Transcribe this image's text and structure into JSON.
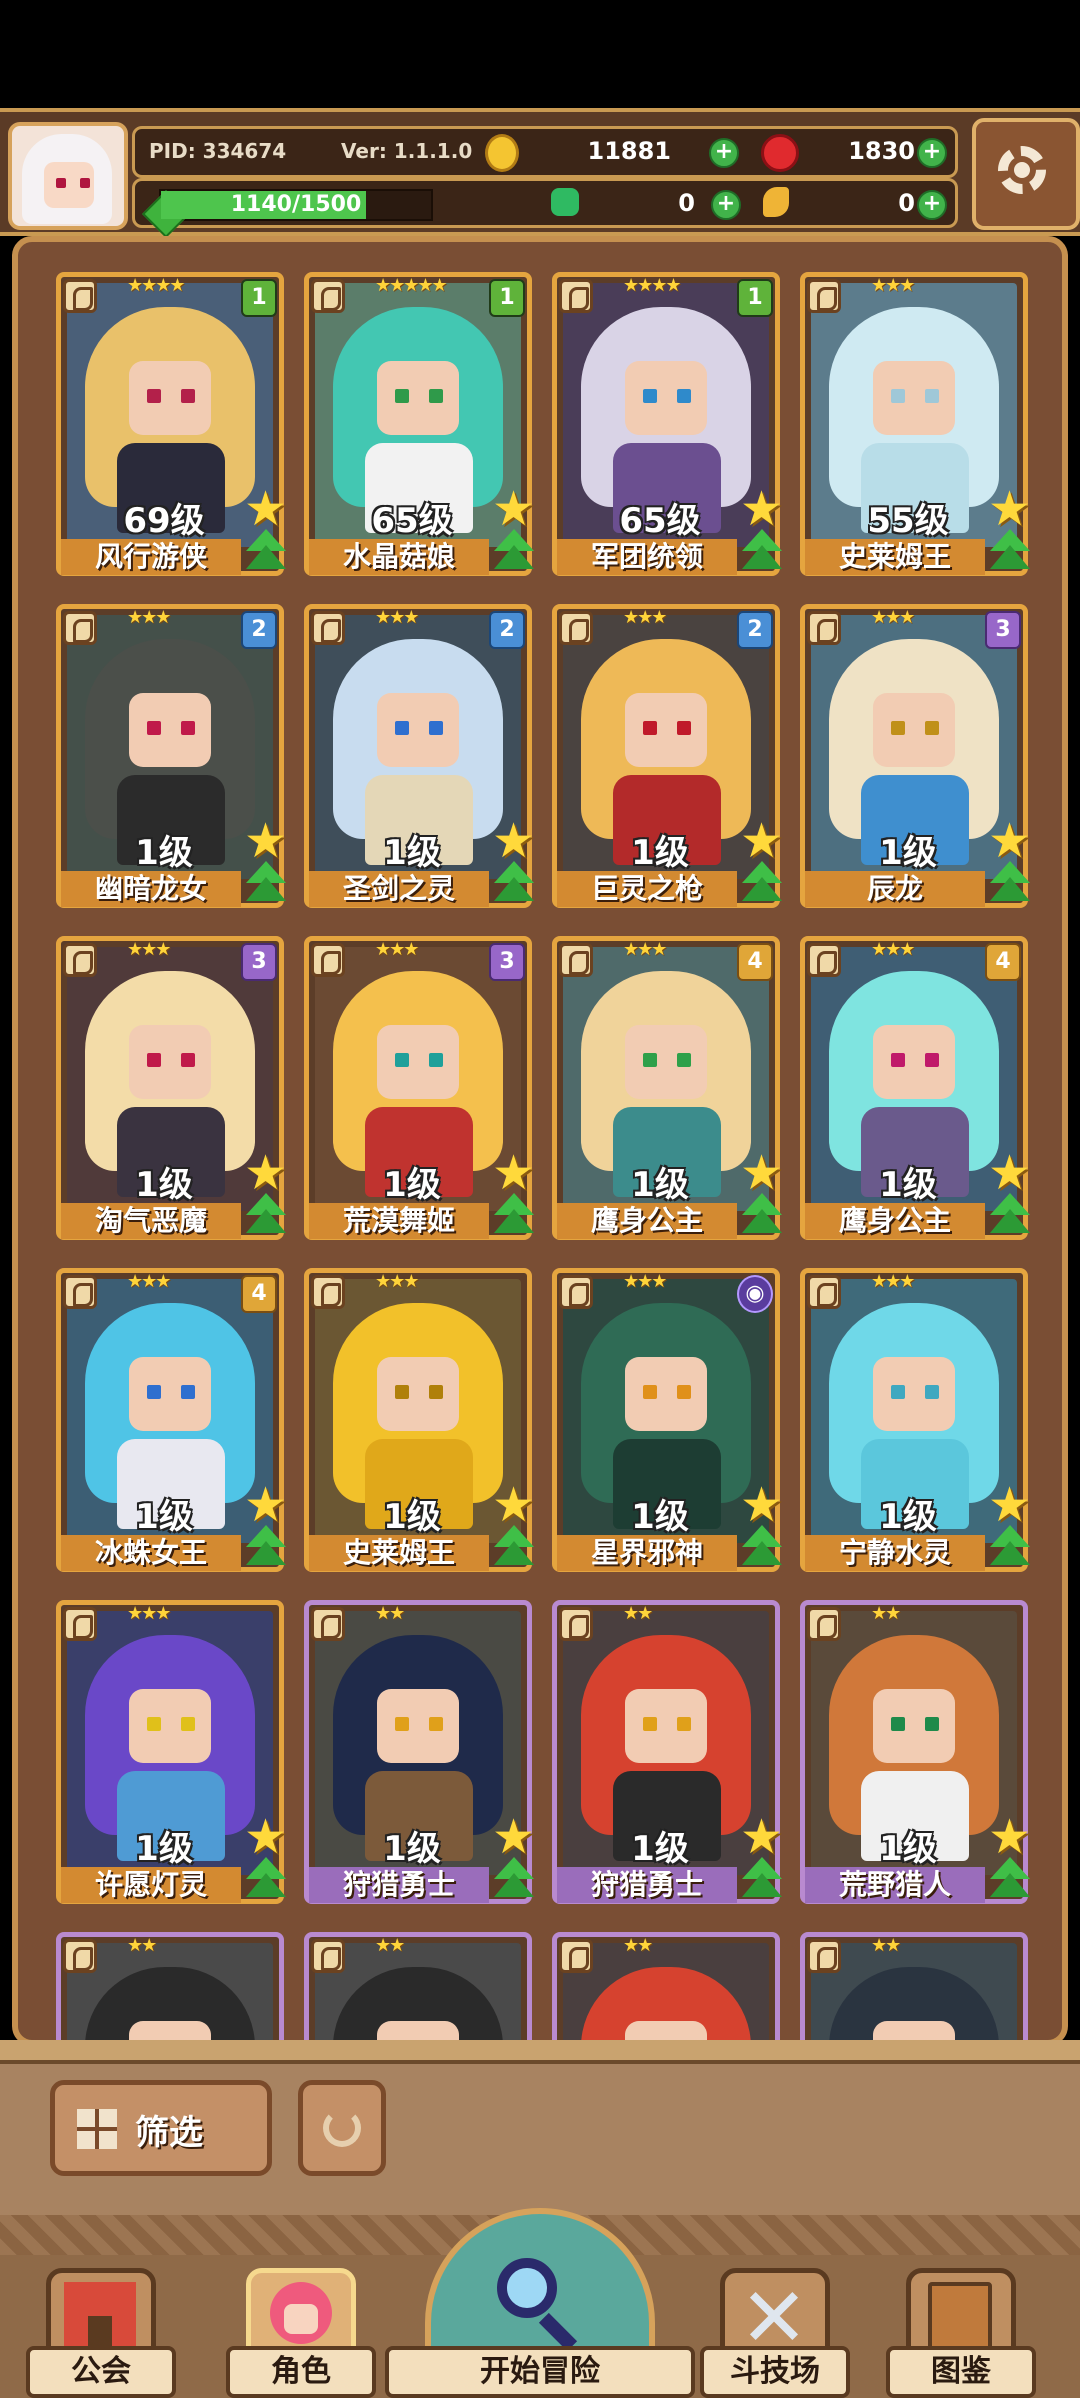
{
  "hud": {
    "pid": "PID: 334674",
    "version": "Ver: 1.1.1.0",
    "gold": "11881",
    "gems": "1830",
    "xp_text": "1140/1500",
    "xp_fraction": 0.76,
    "clover": "0",
    "feather": "0"
  },
  "cards": [
    {
      "name": "风行游侠",
      "level": "69级",
      "stars": "★★★★",
      "badge": "1",
      "badge_type": "b1",
      "frame": "gold",
      "hair": "#e9c16a",
      "body": "#2a2a3a",
      "eye": "#b3204a",
      "bg": "#4a5f78"
    },
    {
      "name": "水晶菇娘",
      "level": "65级",
      "stars": "★★★★★",
      "badge": "1",
      "badge_type": "b1",
      "frame": "gold",
      "hair": "#43c7b2",
      "body": "#f2f2f2",
      "eye": "#2f9a4a",
      "bg": "#5b7d6a"
    },
    {
      "name": "军团统领",
      "level": "65级",
      "stars": "★★★★",
      "badge": "1",
      "badge_type": "b1",
      "frame": "gold",
      "hair": "#d9d3e6",
      "body": "#6b4f90",
      "eye": "#2f8acb",
      "bg": "#4a3d58"
    },
    {
      "name": "史莱姆王",
      "level": "55级",
      "stars": "★★★",
      "badge": "",
      "badge_type": "",
      "frame": "gold",
      "hair": "#cfeaf2",
      "body": "#b8dde8",
      "eye": "#9fc8d8",
      "bg": "#5c7c8c"
    },
    {
      "name": "幽暗龙女",
      "level": "1级",
      "stars": "★★★",
      "badge": "2",
      "badge_type": "b2",
      "frame": "gold",
      "hair": "#4b4f4a",
      "body": "#2b2b2b",
      "eye": "#c01a4a",
      "bg": "#44504a"
    },
    {
      "name": "圣剑之灵",
      "level": "1级",
      "stars": "★★★",
      "badge": "2",
      "badge_type": "b2",
      "frame": "gold",
      "hair": "#c8dcef",
      "body": "#e4d7b7",
      "eye": "#2f6fcf",
      "bg": "#3f4e5a"
    },
    {
      "name": "巨灵之枪",
      "level": "1级",
      "stars": "★★★",
      "badge": "2",
      "badge_type": "b2",
      "frame": "gold",
      "hair": "#eeb957",
      "body": "#b32a2a",
      "eye": "#c01a2a",
      "bg": "#4a4340"
    },
    {
      "name": "辰龙",
      "level": "1级",
      "stars": "★★★",
      "badge": "3",
      "badge_type": "b3",
      "frame": "gold",
      "hair": "#efe2c5",
      "body": "#3f8fcf",
      "eye": "#c0901a",
      "bg": "#4d6f80"
    },
    {
      "name": "淘气恶魔",
      "level": "1级",
      "stars": "★★★",
      "badge": "3",
      "badge_type": "b3",
      "frame": "gold",
      "hair": "#f3dca8",
      "body": "#3a3340",
      "eye": "#c01a4a",
      "bg": "#503a3a"
    },
    {
      "name": "荒漠舞姬",
      "level": "1级",
      "stars": "★★★",
      "badge": "3",
      "badge_type": "b3",
      "frame": "gold",
      "hair": "#f4c04d",
      "body": "#c0332f",
      "eye": "#1fa09a",
      "bg": "#6b4a33"
    },
    {
      "name": "鹰身公主",
      "level": "1级",
      "stars": "★★★",
      "badge": "4",
      "badge_type": "b4",
      "frame": "gold",
      "hair": "#f0d39a",
      "body": "#3c8c8c",
      "eye": "#2fa04a",
      "bg": "#4f6a6a"
    },
    {
      "name": "鹰身公主",
      "level": "1级",
      "stars": "★★★",
      "badge": "4",
      "badge_type": "b4",
      "frame": "gold",
      "hair": "#7fe4e0",
      "body": "#6a5a8c",
      "eye": "#c01a6a",
      "bg": "#3f5e74"
    },
    {
      "name": "冰蛛女王",
      "level": "1级",
      "stars": "★★★",
      "badge": "4",
      "badge_type": "b4",
      "frame": "gold",
      "hair": "#4fc4e6",
      "body": "#e8e8f0",
      "eye": "#2f6fcf",
      "bg": "#3c5e74"
    },
    {
      "name": "史莱姆王",
      "level": "1级",
      "stars": "★★★",
      "badge": "",
      "badge_type": "",
      "frame": "gold",
      "hair": "#f2c12a",
      "body": "#e0a81a",
      "eye": "#b0800a",
      "bg": "#6b5733"
    },
    {
      "name": "星界邪神",
      "level": "1级",
      "stars": "★★★",
      "badge": "◉",
      "badge_type": "orb",
      "frame": "gold",
      "hair": "#2f6b55",
      "body": "#1d3d33",
      "eye": "#e0901a",
      "bg": "#2e4840"
    },
    {
      "name": "宁静水灵",
      "level": "1级",
      "stars": "★★★",
      "badge": "",
      "badge_type": "",
      "frame": "gold",
      "hair": "#6fd8e8",
      "body": "#5bc7dc",
      "eye": "#3fa8c0",
      "bg": "#3f6a7a"
    },
    {
      "name": "许愿灯灵",
      "level": "1级",
      "stars": "★★★",
      "badge": "",
      "badge_type": "",
      "frame": "gold",
      "hair": "#6a48c8",
      "body": "#4f9bd4",
      "eye": "#e0c01a",
      "bg": "#3a3f6a"
    },
    {
      "name": "狩猎勇士",
      "level": "1级",
      "stars": "★★",
      "badge": "",
      "badge_type": "",
      "frame": "purple",
      "hair": "#1f2a4a",
      "body": "#7c5a3a",
      "eye": "#e0a01a",
      "bg": "#4a4a44"
    },
    {
      "name": "狩猎勇士",
      "level": "1级",
      "stars": "★★",
      "badge": "",
      "badge_type": "",
      "frame": "purple",
      "hair": "#d6422f",
      "body": "#2a2a2a",
      "eye": "#e0a01a",
      "bg": "#4a3f3f"
    },
    {
      "name": "荒野猎人",
      "level": "1级",
      "stars": "★★",
      "badge": "",
      "badge_type": "",
      "frame": "purple",
      "hair": "#d0783a",
      "body": "#f0f0f0",
      "eye": "#1f8a4a",
      "bg": "#5a4a3a"
    },
    {
      "name": "",
      "level": "",
      "stars": "★★",
      "badge": "",
      "badge_type": "",
      "frame": "purple",
      "hair": "#2a2a2a",
      "body": "#f0f0f0",
      "eye": "#c01a4a",
      "bg": "#4a4a4a"
    },
    {
      "name": "",
      "level": "",
      "stars": "★★",
      "badge": "",
      "badge_type": "",
      "frame": "purple",
      "hair": "#2a2a2a",
      "body": "#e0d0b0",
      "eye": "#2f8a4a",
      "bg": "#4a4a4a"
    },
    {
      "name": "",
      "level": "",
      "stars": "★★",
      "badge": "",
      "badge_type": "",
      "frame": "purple",
      "hair": "#d6422f",
      "body": "#3a2a2a",
      "eye": "#c01a2a",
      "bg": "#4a3f3f"
    },
    {
      "name": "",
      "level": "",
      "stars": "★★",
      "badge": "",
      "badge_type": "",
      "frame": "purple",
      "hair": "#2a3440",
      "body": "#3a3a3a",
      "eye": "#c01a4a",
      "bg": "#3f4a50"
    }
  ],
  "controls": {
    "filter_label": "筛选"
  },
  "nav": {
    "guild": "公会",
    "role": "角色",
    "adventure": "开始冒险",
    "arena": "斗技场",
    "atlas": "图鉴"
  }
}
